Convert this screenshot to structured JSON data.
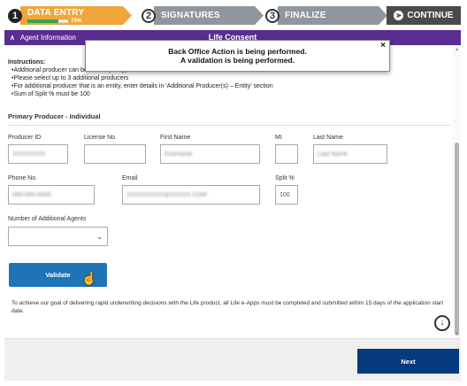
{
  "steps": [
    {
      "number": "1",
      "label": "DATA ENTRY",
      "progress_text": "75%",
      "progress": 0.75,
      "state": "active"
    },
    {
      "number": "2",
      "label": "SIGNATURES",
      "state": "pending"
    },
    {
      "number": "3",
      "label": "FINALIZE",
      "state": "pending"
    }
  ],
  "continue_button": {
    "label": "CONTINUE",
    "icon": "arrow-right-circle-icon"
  },
  "header": {
    "left_label": "Agent Information",
    "collapse_icon": "chevron-double-up",
    "title": "Life Consent"
  },
  "overlay": {
    "line1": "Back Office Action is being performed.",
    "line2": "A validation is being performed.",
    "close": "×"
  },
  "instructions": {
    "heading": "Instructions:",
    "items": [
      "Additional producer can be added (if any)",
      "Please select up to 3 additional producers",
      "For additional producer that is an entity, enter details in 'Additional Producer(s) – Entity' section",
      "Sum of Split % must be 100"
    ]
  },
  "section_title": "Primary Producer - Individual",
  "fields": {
    "producer_id": {
      "label": "Producer ID",
      "value": "XXXXXXXX"
    },
    "license_no": {
      "label": "License No.",
      "value": ""
    },
    "first_name": {
      "label": "First Name",
      "value": "Firstname"
    },
    "mi": {
      "label": "MI",
      "value": ""
    },
    "last_name": {
      "label": "Last Name",
      "value": "Last Name"
    },
    "phone_no": {
      "label": "Phone No.",
      "value": "000-000-0000"
    },
    "email": {
      "label": "Email",
      "value": "XXXXXXXXX@XXXXX.COM"
    },
    "split": {
      "label": "Split %",
      "value": "100"
    },
    "num_agents": {
      "label": "Number of Additional Agents",
      "value": ""
    }
  },
  "validate_button": "Validate",
  "notice": "To achieve our goal of delivering rapid underwriting decisions with the Life product, all Life e-Apps must be completed and submitted within 15 days of the application start date.",
  "next_button": "Next",
  "colors": {
    "accent": "#f0a63c",
    "header": "#5a2d91",
    "primary_button": "#1f73b7",
    "next_button": "#053a7c",
    "progress": "#2fa84f"
  }
}
